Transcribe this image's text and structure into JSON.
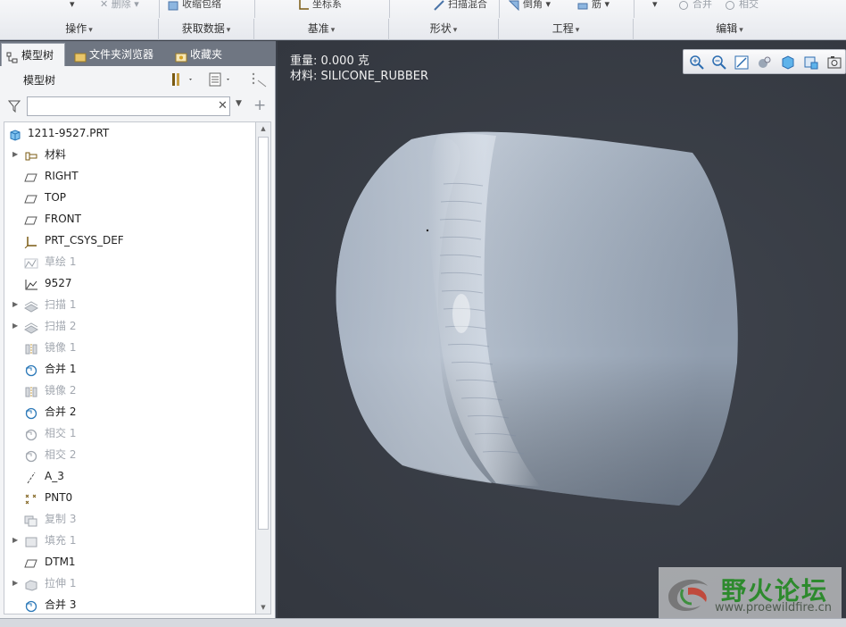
{
  "ribbon": {
    "top_buttons": [
      {
        "label": "删除",
        "dim": true
      },
      {
        "label": "收缩包络",
        "dim": false
      },
      {
        "label": "坐标系",
        "dim": false
      },
      {
        "label": "扫描混合",
        "dim": false
      },
      {
        "label": "倒角",
        "dim": false
      },
      {
        "label": "筋",
        "dim": false
      },
      {
        "label": "合并",
        "dim": true
      },
      {
        "label": "相交",
        "dim": true
      }
    ],
    "groups": [
      "操作",
      "获取数据",
      "基准",
      "形状",
      "工程",
      "编辑"
    ]
  },
  "panel": {
    "tabs": [
      "模型树",
      "文件夹浏览器",
      "收藏夹"
    ],
    "tree_title": "模型树",
    "search_value": "",
    "search_placeholder": ""
  },
  "tree": {
    "root": "1211-9527.PRT",
    "nodes": [
      {
        "label": "材料",
        "icon": "material-icon",
        "expandable": true,
        "dim": false
      },
      {
        "label": "RIGHT",
        "icon": "datum-plane-icon",
        "expandable": false,
        "dim": false
      },
      {
        "label": "TOP",
        "icon": "datum-plane-icon",
        "expandable": false,
        "dim": false
      },
      {
        "label": "FRONT",
        "icon": "datum-plane-icon",
        "expandable": false,
        "dim": false
      },
      {
        "label": "PRT_CSYS_DEF",
        "icon": "csys-icon",
        "expandable": false,
        "dim": false
      },
      {
        "label": "草绘 1",
        "icon": "sketch-icon",
        "expandable": false,
        "dim": true
      },
      {
        "label": "9527",
        "icon": "graph-icon",
        "expandable": false,
        "dim": false
      },
      {
        "label": "扫描 1",
        "icon": "sweep-icon",
        "expandable": true,
        "dim": true
      },
      {
        "label": "扫描 2",
        "icon": "sweep-icon",
        "expandable": true,
        "dim": true
      },
      {
        "label": "镜像 1",
        "icon": "mirror-icon",
        "expandable": false,
        "dim": true
      },
      {
        "label": "合并 1",
        "icon": "merge-icon",
        "expandable": false,
        "dim": false
      },
      {
        "label": "镜像 2",
        "icon": "mirror-icon",
        "expandable": false,
        "dim": true
      },
      {
        "label": "合并 2",
        "icon": "merge-icon",
        "expandable": false,
        "dim": false
      },
      {
        "label": "相交 1",
        "icon": "intersect-icon",
        "expandable": false,
        "dim": true
      },
      {
        "label": "相交 2",
        "icon": "intersect-icon",
        "expandable": false,
        "dim": true
      },
      {
        "label": "A_3",
        "icon": "axis-icon",
        "expandable": false,
        "dim": false
      },
      {
        "label": "PNT0",
        "icon": "datum-point-icon",
        "expandable": false,
        "dim": false
      },
      {
        "label": "复制 3",
        "icon": "copy-icon",
        "expandable": false,
        "dim": true
      },
      {
        "label": "填充 1",
        "icon": "fill-icon",
        "expandable": true,
        "dim": true
      },
      {
        "label": "DTM1",
        "icon": "datum-plane-icon",
        "expandable": false,
        "dim": false
      },
      {
        "label": "拉伸 1",
        "icon": "extrude-icon",
        "expandable": true,
        "dim": true
      },
      {
        "label": "合并 3",
        "icon": "merge-icon",
        "expandable": false,
        "dim": false
      }
    ]
  },
  "viewport": {
    "weight": "重量: 0.000 克",
    "material": "材料: SILICONE_RUBBER"
  },
  "watermark": {
    "title": "野火论坛",
    "url": "www.proewildfire.cn"
  }
}
